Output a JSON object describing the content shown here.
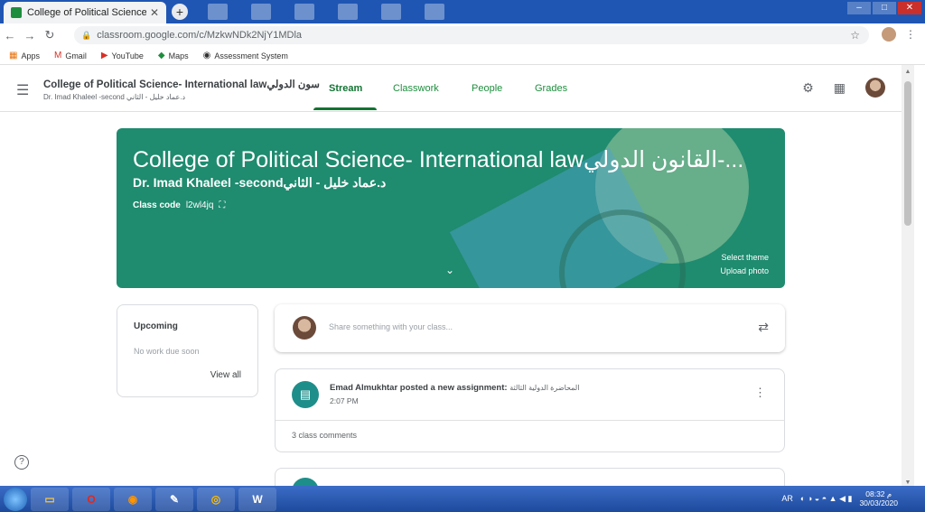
{
  "browser": {
    "tab_title": "College of Political Science- Inte",
    "url": "classroom.google.com/c/MzkwNDk2NjY1MDla",
    "bookmarks": [
      "Apps",
      "Gmail",
      "YouTube",
      "Maps",
      "Assessment System"
    ]
  },
  "header": {
    "course_title": "College of Political Science- International lawسون الدولي",
    "course_subtitle": "Dr. Imad Khaleel -second د.عماد خليل - الثاني",
    "tabs": [
      "Stream",
      "Classwork",
      "People",
      "Grades"
    ],
    "active_tab": "Stream"
  },
  "banner": {
    "title": "College of Political Science- International lawالقانون الدولي-...",
    "subtitle": "Dr. Imad Khaleel -secondد.عماد خليل - الثاني",
    "class_code_label": "Class code",
    "class_code": "l2wl4jq",
    "select_theme": "Select theme",
    "upload_photo": "Upload photo",
    "color": "#1f8b6f"
  },
  "upcoming": {
    "title": "Upcoming",
    "empty": "No work due soon",
    "view_all": "View all"
  },
  "share": {
    "placeholder": "Share something with your class..."
  },
  "post": {
    "author_action": "Emad Almukhtar posted a new assignment:",
    "assignment": "المحاضرة الدولية الثالثة",
    "time": "2:07 PM",
    "comments": "3 class comments"
  },
  "taskbar": {
    "language": "AR",
    "time": "08:32 م",
    "date": "30/03/2020"
  }
}
